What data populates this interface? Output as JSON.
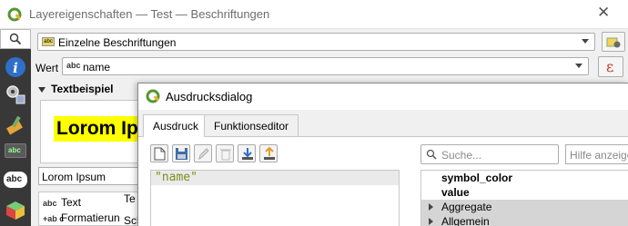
{
  "window": {
    "title": "Layereigenschaften — Test — Beschriftungen",
    "close_glyph": "✕"
  },
  "sidebar": {
    "search_icon": "search-icon",
    "items": [
      {
        "icon": "info-icon"
      },
      {
        "icon": "source-icon"
      },
      {
        "icon": "symbology-icon"
      },
      {
        "icon": "labels-icon",
        "text": "abc"
      },
      {
        "icon": "masks-icon",
        "text": "abc"
      },
      {
        "icon": "3d-view-icon"
      }
    ]
  },
  "label_mode": {
    "selected": "Einzelne Beschriftungen",
    "badge": "abc"
  },
  "value_field": {
    "label": "Wert",
    "badge": "abc",
    "value": "name",
    "expression_button": "ε"
  },
  "text_sample": {
    "section_title": "Textbeispiel",
    "preview_text": "Lorom Ipsum",
    "sample_value": "Lorom Ipsum"
  },
  "settings_list": {
    "items": [
      {
        "icon": "abc",
        "label": "Text"
      },
      {
        "icon": "+ab c",
        "label": "Formatierun"
      }
    ],
    "side_labels": [
      "Te",
      "Sch"
    ]
  },
  "dialog": {
    "title": "Ausdrucksdialog",
    "tabs": [
      {
        "label": "Ausdruck",
        "active": true
      },
      {
        "label": "Funktionseditor",
        "active": false
      }
    ],
    "toolbar": [
      "new-file-icon",
      "save-icon",
      "edit-icon",
      "delete-icon",
      "import-icon",
      "export-icon"
    ],
    "expression": "\"name\"",
    "search_placeholder": "Suche...",
    "help_placeholder": "Hilfe anzeigen",
    "tree": [
      {
        "label": "symbol_color",
        "bold": true,
        "group": false
      },
      {
        "label": "value",
        "bold": true,
        "group": false
      },
      {
        "label": "Aggregate",
        "bold": false,
        "group": true
      },
      {
        "label": "Allgemein",
        "bold": false,
        "group": true
      }
    ]
  },
  "colors": {
    "sidebar_bg": "#383838",
    "preview_highlight": "#ffff00",
    "expression_text": "#7a8f1a",
    "qgis_green": "#589632"
  }
}
